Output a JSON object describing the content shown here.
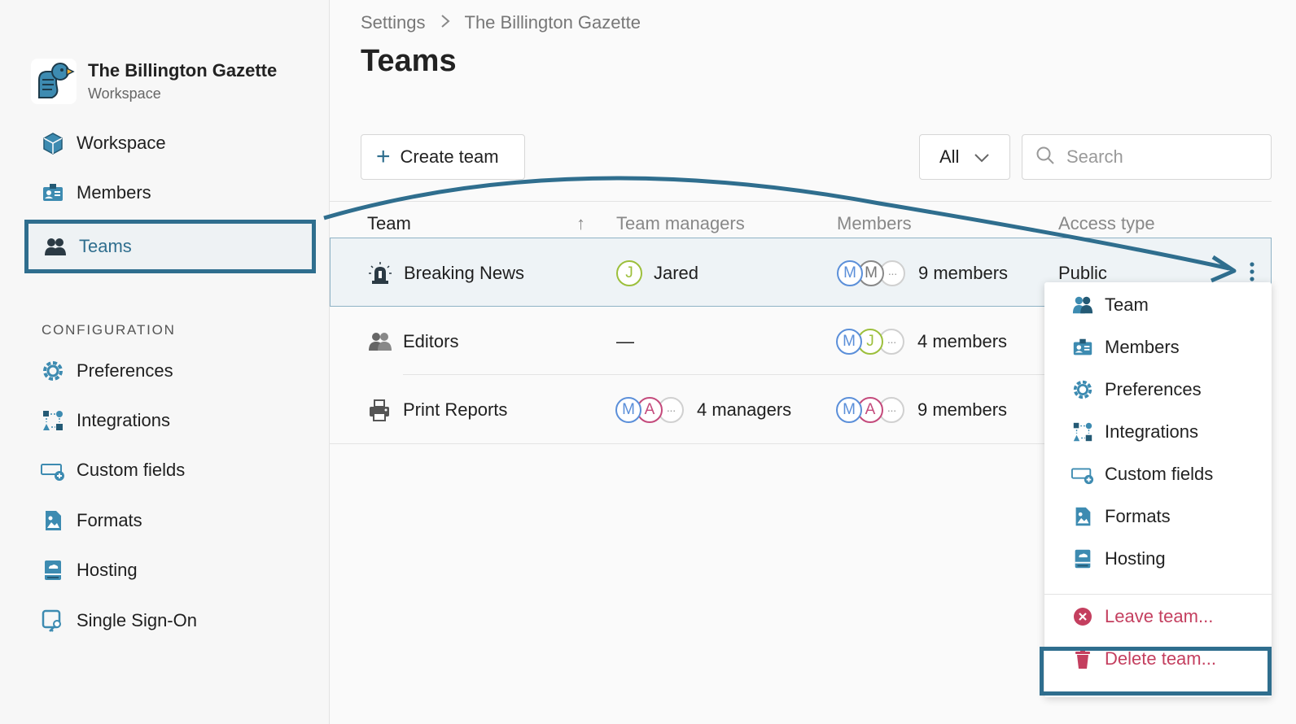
{
  "org": {
    "name": "The Billington Gazette",
    "subtitle": "Workspace"
  },
  "sidebar": {
    "items": [
      {
        "label": "Workspace",
        "icon": "workspace-icon"
      },
      {
        "label": "Members",
        "icon": "members-icon"
      },
      {
        "label": "Teams",
        "icon": "teams-icon",
        "active": true
      }
    ],
    "config_label": "CONFIGURATION",
    "config_items": [
      {
        "label": "Preferences",
        "icon": "preferences-icon"
      },
      {
        "label": "Integrations",
        "icon": "integrations-icon"
      },
      {
        "label": "Custom fields",
        "icon": "custom-fields-icon"
      },
      {
        "label": "Formats",
        "icon": "formats-icon"
      },
      {
        "label": "Hosting",
        "icon": "hosting-icon"
      },
      {
        "label": "Single Sign-On",
        "icon": "sso-icon"
      }
    ]
  },
  "breadcrumb": {
    "parent": "Settings",
    "separator": ">",
    "current": "The Billington Gazette"
  },
  "page": {
    "title": "Teams"
  },
  "toolbar": {
    "create_label": "Create team",
    "filter_value": "All",
    "search_placeholder": "Search"
  },
  "table": {
    "headers": {
      "team": "Team",
      "sort_indicator": "↑",
      "managers": "Team managers",
      "members": "Members",
      "access": "Access type"
    },
    "rows": [
      {
        "name": "Breaking News",
        "icon": "siren-icon",
        "manager_initial": "J",
        "manager_text": "Jared",
        "member_initials": [
          "M",
          "M"
        ],
        "members_text": "9 members",
        "access": "Public"
      },
      {
        "name": "Editors",
        "icon": "team-icon",
        "manager_text": "—",
        "member_initials": [
          "M",
          "J"
        ],
        "members_text": "4 members"
      },
      {
        "name": "Print Reports",
        "icon": "printer-icon",
        "manager_initials": [
          "M",
          "A"
        ],
        "manager_text": "4 managers",
        "member_initials": [
          "M",
          "A"
        ],
        "members_text": "9 members"
      }
    ],
    "ellipsis": "···"
  },
  "menu": {
    "items": [
      {
        "label": "Team",
        "icon": "team-icon"
      },
      {
        "label": "Members",
        "icon": "members-icon"
      },
      {
        "label": "Preferences",
        "icon": "preferences-icon"
      },
      {
        "label": "Integrations",
        "icon": "integrations-icon"
      },
      {
        "label": "Custom fields",
        "icon": "custom-fields-icon"
      },
      {
        "label": "Formats",
        "icon": "formats-icon"
      },
      {
        "label": "Hosting",
        "icon": "hosting-icon"
      }
    ],
    "leave_label": "Leave team...",
    "delete_label": "Delete team..."
  },
  "colors": {
    "accent": "#2f6e8e",
    "danger": "#c43f5f",
    "avatar_m": "#5b8fd9",
    "avatar_j": "#9cbf3b",
    "avatar_a": "#c44a7c"
  }
}
